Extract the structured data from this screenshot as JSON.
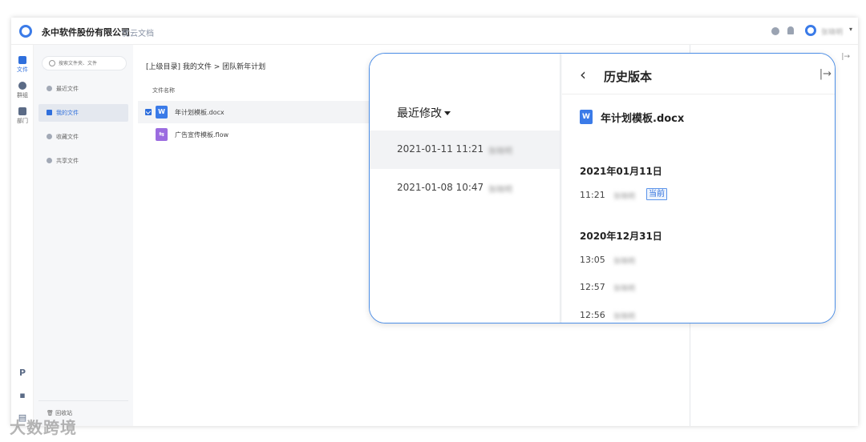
{
  "header": {
    "company": "永中软件股份有限公司",
    "product": "优云文档",
    "user": "张晓明"
  },
  "rail": {
    "files": "文件",
    "groups": "群组",
    "department": "部门"
  },
  "nav": {
    "search_placeholder": "搜索文件夹、文件",
    "items": [
      {
        "label": "最近文件"
      },
      {
        "label": "我的文件"
      },
      {
        "label": "收藏文件"
      },
      {
        "label": "共享文件"
      }
    ],
    "trash": "回收站"
  },
  "main": {
    "breadcrumb": "[上级目录] 我的文件 > 团队新年计划",
    "column_name": "文件名称",
    "files": [
      {
        "name": "年计划模板.docx",
        "type": "word"
      },
      {
        "name": "广告宣传模板.flow",
        "type": "flow"
      }
    ]
  },
  "history": {
    "sort_label": "最近修改",
    "recent": [
      {
        "time": "2021-01-11 11:21",
        "user": "张晓明"
      },
      {
        "time": "2021-01-08 10:47",
        "user": "张晓明"
      }
    ],
    "title": "历史版本",
    "doc_name": "年计划模板.docx",
    "groups": [
      {
        "date": "2021年01月11日",
        "versions": [
          {
            "time": "11:21",
            "user": "张晓明",
            "badge": "当前"
          }
        ]
      },
      {
        "date": "2020年12月31日",
        "versions": [
          {
            "time": "13:05",
            "user": "张晓明"
          },
          {
            "time": "12:57",
            "user": "张晓明"
          },
          {
            "time": "12:56",
            "user": "张晓明"
          }
        ]
      }
    ]
  },
  "watermark": "大数跨境",
  "colors": {
    "accent": "#2f6fdc",
    "callout_border": "#4c8ee6",
    "word": "#3b7be8",
    "flow": "#9b6ce0"
  }
}
